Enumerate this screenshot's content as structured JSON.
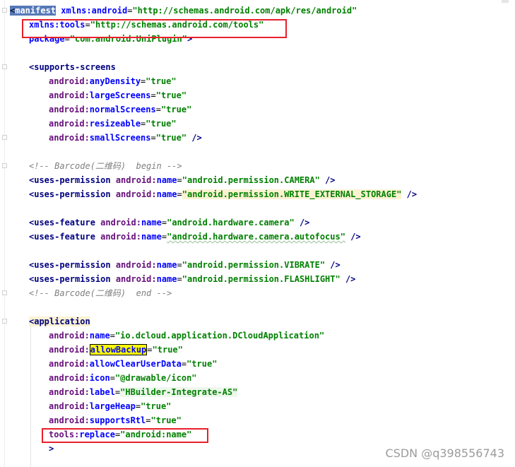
{
  "xml": {
    "line1": {
      "tag": "manifest",
      "attr": "xmlns:android",
      "eq": "=",
      "value": "\"http://schemas.android.com/apk/res/android\""
    },
    "line2": {
      "attr": "xmlns:tools",
      "eq": "=",
      "value": "\"http://schemas.android.com/tools\""
    },
    "line3": {
      "attr": "package",
      "eq": "=",
      "value": "\"com.android.UniPlugin\"",
      "close": ">"
    },
    "supports_screens": {
      "tag": "<supports-screens",
      "attrs": [
        {
          "ns": "android:",
          "name": "anyDensity",
          "value": "\"true\""
        },
        {
          "ns": "android:",
          "name": "largeScreens",
          "value": "\"true\""
        },
        {
          "ns": "android:",
          "name": "normalScreens",
          "value": "\"true\""
        },
        {
          "ns": "android:",
          "name": "resizeable",
          "value": "\"true\""
        },
        {
          "ns": "android:",
          "name": "smallScreens",
          "value": "\"true\""
        }
      ],
      "close": " />"
    },
    "comment_begin": "<!-- Barcode(二维码)  begin -->",
    "comment_end": "<!-- Barcode(二维码)  end -->",
    "permissions_a": [
      {
        "tag": "<uses-permission",
        "ns": "android:",
        "name": "name",
        "value": "\"android.permission.CAMERA\""
      },
      {
        "tag": "<uses-permission",
        "ns": "android:",
        "name": "name",
        "value": "\"android.permission.WRITE_EXTERNAL_STORAGE\""
      }
    ],
    "features": [
      {
        "tag": "<uses-feature",
        "ns": "android:",
        "name": "name",
        "value": "\"android.hardware.camera\""
      },
      {
        "tag": "<uses-feature",
        "ns": "android:",
        "name": "name",
        "value": "\"android.hardware.camera.autofocus\""
      }
    ],
    "permissions_b": [
      {
        "tag": "<uses-permission",
        "ns": "android:",
        "name": "name",
        "value": "\"android.permission.VIBRATE\""
      },
      {
        "tag": "<uses-permission",
        "ns": "android:",
        "name": "name",
        "value": "\"android.permission.FLASHLIGHT\""
      }
    ],
    "tag_close": " />",
    "application": {
      "tag": "<application",
      "attrs": [
        {
          "ns": "android:",
          "name": "name",
          "value": "\"io.dcloud.application.DCloudApplication\""
        },
        {
          "ns": "android:",
          "name": "allowBackup",
          "value": "\"true\""
        },
        {
          "ns": "android:",
          "name": "allowClearUserData",
          "value": "\"true\""
        },
        {
          "ns": "android:",
          "name": "icon",
          "value": "\"@drawable/icon\""
        },
        {
          "ns": "android:",
          "name": "label",
          "value": "\"HBuilder-Integrate-AS\""
        },
        {
          "ns": "android:",
          "name": "largeHeap",
          "value": "\"true\""
        },
        {
          "ns": "android:",
          "name": "supportsRtl",
          "value": "\"true\""
        },
        {
          "ns": "tools:",
          "name": "replace",
          "value": "\"android:name\""
        }
      ],
      "close": ">"
    }
  },
  "watermark": "CSDN @q398556743",
  "colors": {
    "annotation": "#e8202a",
    "tag": "#000080",
    "attr": "#0000ff",
    "value": "#008000",
    "comment": "#808080"
  }
}
